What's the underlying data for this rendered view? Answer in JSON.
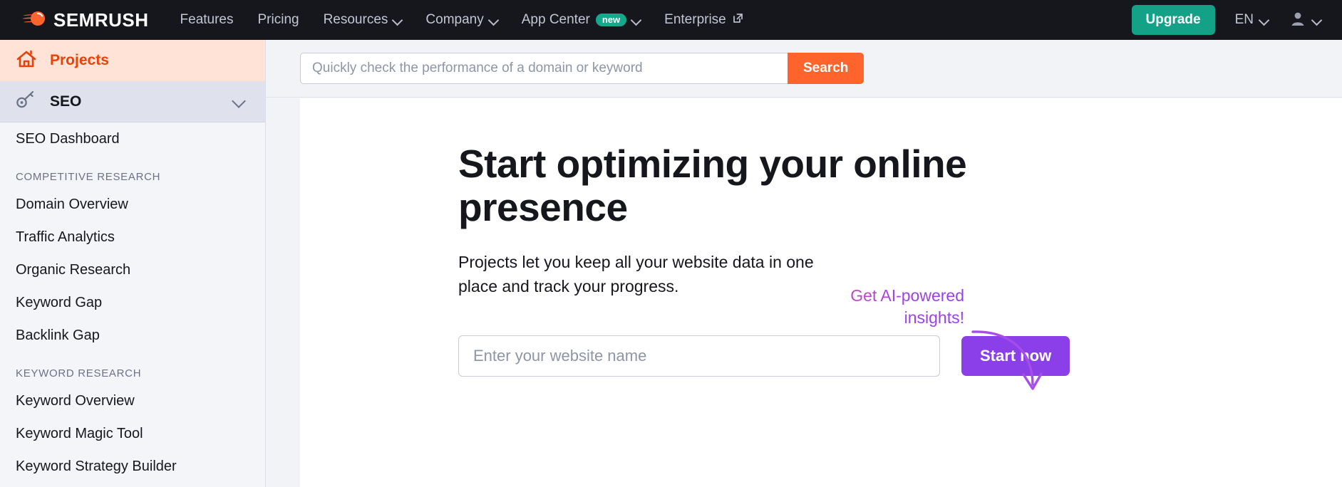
{
  "topnav": {
    "brand": "SEMRUSH",
    "brand_icon": "semrush-comet-logo",
    "links": [
      {
        "label": "Features",
        "icon": null,
        "badge": null
      },
      {
        "label": "Pricing",
        "icon": null,
        "badge": null
      },
      {
        "label": "Resources",
        "icon": "chevron-down-icon",
        "badge": null
      },
      {
        "label": "Company",
        "icon": "chevron-down-icon",
        "badge": null
      },
      {
        "label": "App Center",
        "icon": "chevron-down-icon",
        "badge": "new"
      },
      {
        "label": "Enterprise",
        "icon": "external-link-icon",
        "badge": null
      }
    ],
    "upgrade_label": "Upgrade",
    "language": "EN",
    "colors": {
      "bar_bg": "#16161d",
      "upgrade_green": "#13a287",
      "badge_green": "#13a98a"
    }
  },
  "sidebar": {
    "projects": {
      "label": "Projects",
      "icon": "home-icon",
      "active": true
    },
    "seo": {
      "label": "SEO",
      "icon": "key-icon",
      "chevron": "chevron-down-icon",
      "expanded": true
    },
    "dashboard_item": "SEO Dashboard",
    "groups": [
      {
        "heading": "COMPETITIVE RESEARCH",
        "items": [
          "Domain Overview",
          "Traffic Analytics",
          "Organic Research",
          "Keyword Gap",
          "Backlink Gap"
        ]
      },
      {
        "heading": "KEYWORD RESEARCH",
        "items": [
          "Keyword Overview",
          "Keyword Magic Tool",
          "Keyword Strategy Builder"
        ]
      }
    ],
    "colors": {
      "projects_bg": "#ffe3d6",
      "projects_text": "#e8420a",
      "seo_bg": "#dfe1ed",
      "panel_bg": "#f4f5f9"
    }
  },
  "search": {
    "value": "",
    "placeholder": "Quickly check the performance of a domain or keyword",
    "button_label": "Search",
    "button_color": "#ff642d"
  },
  "hero": {
    "heading": "Start optimizing your online presence",
    "subtitle": "Projects let you keep all your website data in one place and track your progress.",
    "website_input": {
      "value": "",
      "placeholder": "Enter your website name"
    },
    "start_button": "Start now",
    "start_button_color": "#8b3fe8",
    "annotation": "Get AI-powered insights!",
    "annotation_gradient_from": "#e0428f",
    "annotation_gradient_to": "#9b3fe8",
    "arrow_icon": "curved-arrow-down-icon"
  }
}
